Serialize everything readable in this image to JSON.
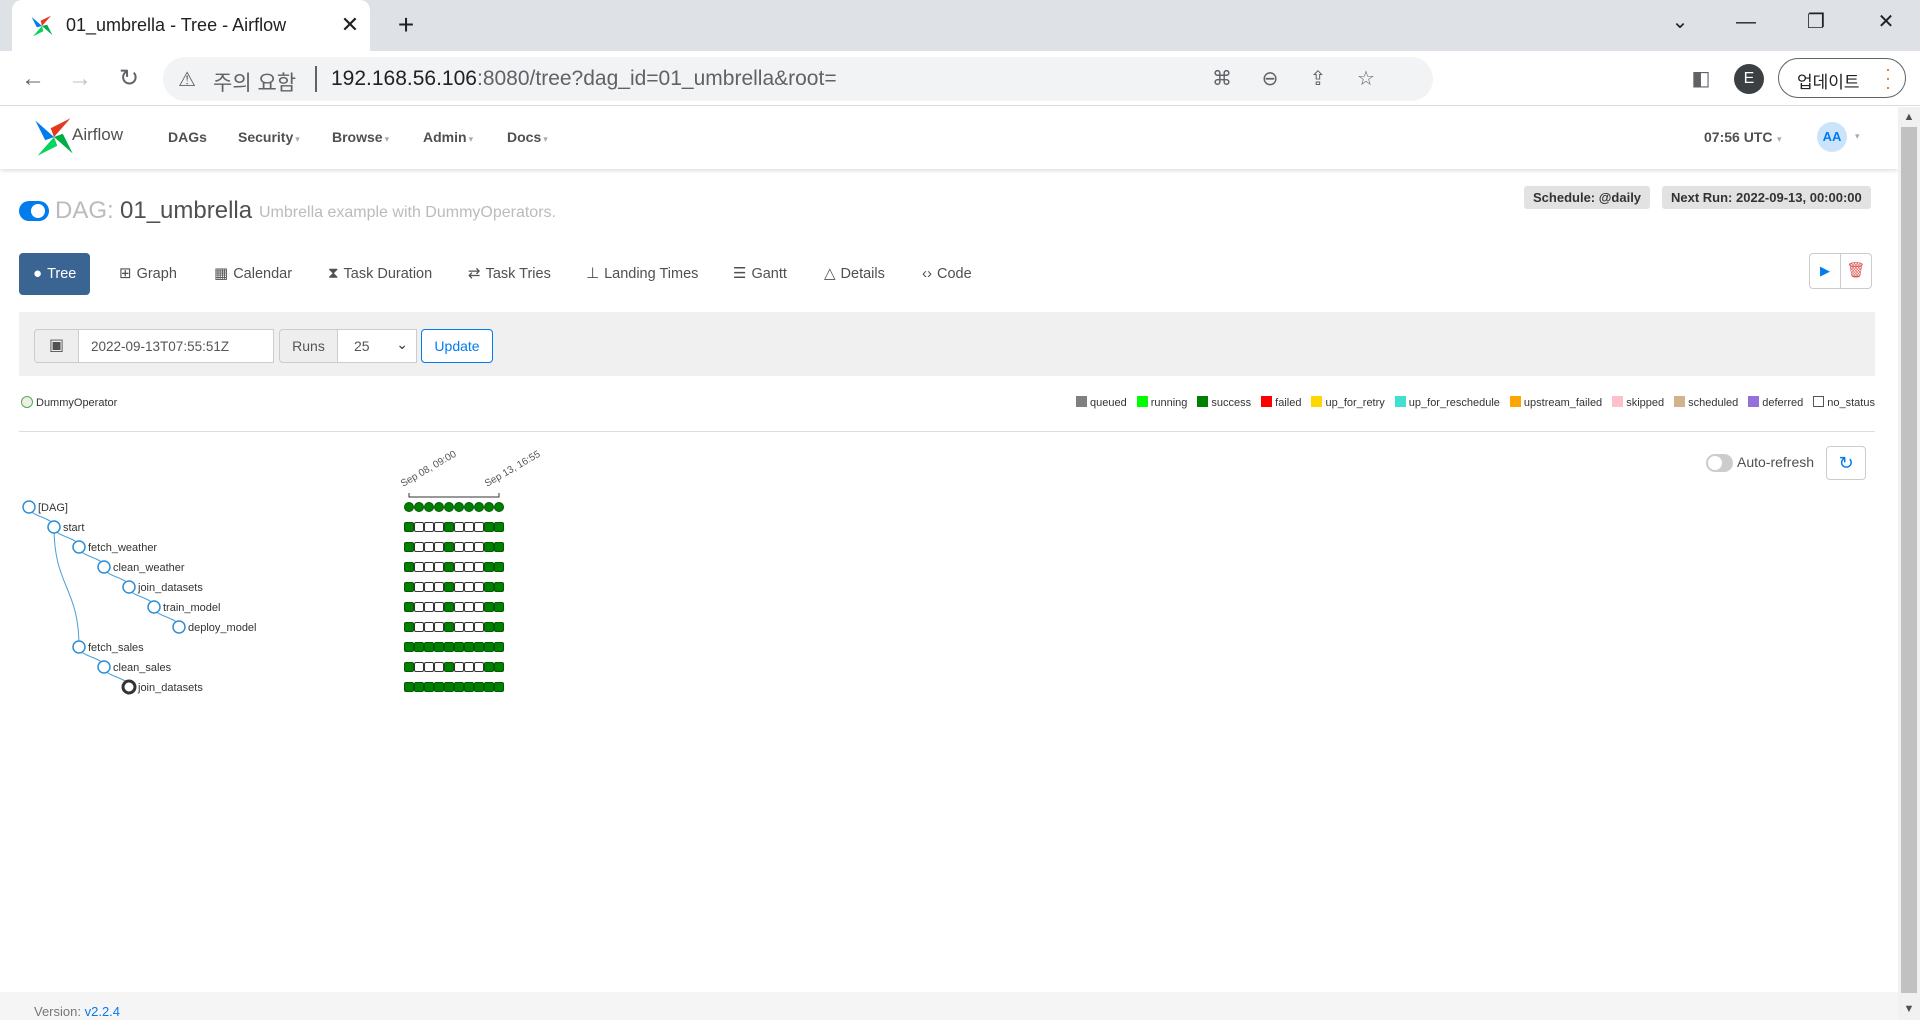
{
  "browser": {
    "tab_title": "01_umbrella - Tree - Airflow",
    "security_warning": "주의 요함",
    "url_host": "192.168.56.106",
    "url_rest": ":8080/tree?dag_id=01_umbrella&root=",
    "profile_initial": "E",
    "update_label": "업데이트"
  },
  "nav": {
    "brand": "Airflow",
    "items": [
      "DAGs",
      "Security",
      "Browse",
      "Admin",
      "Docs"
    ],
    "clock": "07:56 UTC",
    "avatar": "AA"
  },
  "dag": {
    "prefix": "DAG:",
    "id": "01_umbrella",
    "description": "Umbrella example with DummyOperators.",
    "schedule": "Schedule: @daily",
    "next_run": "Next Run: 2022-09-13, 00:00:00",
    "paused": false
  },
  "views": [
    {
      "label": "Tree",
      "icon": "tree-icon",
      "active": true
    },
    {
      "label": "Graph",
      "icon": "graph-icon"
    },
    {
      "label": "Calendar",
      "icon": "calendar-icon"
    },
    {
      "label": "Task Duration",
      "icon": "hourglass-icon"
    },
    {
      "label": "Task Tries",
      "icon": "retry-icon"
    },
    {
      "label": "Landing Times",
      "icon": "plane-landing-icon"
    },
    {
      "label": "Gantt",
      "icon": "gantt-icon"
    },
    {
      "label": "Details",
      "icon": "warning-triangle-icon"
    },
    {
      "label": "Code",
      "icon": "code-icon"
    }
  ],
  "form": {
    "base_date": "2022-09-13T07:55:51Z",
    "runs_label": "Runs",
    "runs_value": "25",
    "update_label": "Update"
  },
  "legend": {
    "operator": "DummyOperator",
    "operator_color": "#f0ede4",
    "states": [
      {
        "name": "queued",
        "color": "#808080"
      },
      {
        "name": "running",
        "color": "#00ff00"
      },
      {
        "name": "success",
        "color": "#008000"
      },
      {
        "name": "failed",
        "color": "#ff0000"
      },
      {
        "name": "up_for_retry",
        "color": "#ffd700"
      },
      {
        "name": "up_for_reschedule",
        "color": "#40e0d0"
      },
      {
        "name": "upstream_failed",
        "color": "#ffa500"
      },
      {
        "name": "skipped",
        "color": "#ffc0cb"
      },
      {
        "name": "scheduled",
        "color": "#d2b48c"
      },
      {
        "name": "deferred",
        "color": "#9370db"
      },
      {
        "name": "no_status",
        "color": "#ffffff"
      }
    ]
  },
  "auto_refresh_label": "Auto-refresh",
  "tree": {
    "date_start": "Sep 08, 09:00",
    "date_end": "Sep 13, 16:55",
    "nodes": [
      {
        "label": "[DAG]",
        "depth": 0
      },
      {
        "label": "start",
        "depth": 1
      },
      {
        "label": "fetch_weather",
        "depth": 2
      },
      {
        "label": "clean_weather",
        "depth": 3
      },
      {
        "label": "join_datasets",
        "depth": 4
      },
      {
        "label": "train_model",
        "depth": 5
      },
      {
        "label": "deploy_model",
        "depth": 6
      },
      {
        "label": "fetch_sales",
        "depth": 2
      },
      {
        "label": "clean_sales",
        "depth": 3
      },
      {
        "label": "join_datasets",
        "depth": 4
      }
    ],
    "runs": [
      [
        "success",
        "success",
        "success",
        "success",
        "success",
        "success",
        "success",
        "success",
        "success",
        "success"
      ],
      [
        "success",
        "no_status",
        "no_status",
        "no_status",
        "success",
        "no_status",
        "no_status",
        "no_status",
        "success",
        "success"
      ],
      [
        "success",
        "no_status",
        "no_status",
        "no_status",
        "success",
        "no_status",
        "no_status",
        "no_status",
        "success",
        "success"
      ],
      [
        "success",
        "no_status",
        "no_status",
        "no_status",
        "success",
        "no_status",
        "no_status",
        "no_status",
        "success",
        "success"
      ],
      [
        "success",
        "no_status",
        "no_status",
        "no_status",
        "success",
        "no_status",
        "no_status",
        "no_status",
        "success",
        "success"
      ],
      [
        "success",
        "no_status",
        "no_status",
        "no_status",
        "success",
        "no_status",
        "no_status",
        "no_status",
        "success",
        "success"
      ],
      [
        "success",
        "no_status",
        "no_status",
        "no_status",
        "success",
        "no_status",
        "no_status",
        "no_status",
        "success",
        "success"
      ],
      [
        "success",
        "success",
        "success",
        "success",
        "success",
        "success",
        "success",
        "success",
        "success",
        "success"
      ],
      [
        "success",
        "no_status",
        "no_status",
        "no_status",
        "success",
        "no_status",
        "no_status",
        "no_status",
        "success",
        "success"
      ],
      [
        "success",
        "success",
        "success",
        "success",
        "success",
        "success",
        "success",
        "success",
        "success",
        "success"
      ]
    ]
  },
  "footer": {
    "label": "Version:",
    "version": "v2.2.4"
  }
}
